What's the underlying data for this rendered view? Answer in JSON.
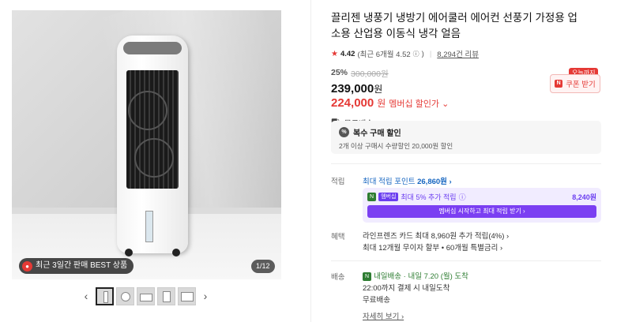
{
  "gallery": {
    "best_badge": "최근 3일간 판매 BEST 상품",
    "counter": "1/12",
    "prev_icon": "chevron-left-icon",
    "next_icon": "chevron-right-icon"
  },
  "product": {
    "title": "끌리젠 냉풍기 냉방기 에어쿨러 에어컨 선풍기 가정용 업소용 산업용 이동식 냉각 얼음",
    "rating": {
      "score": "4.42",
      "recent": "(최근 6개월 4.52",
      "recent_close": ")",
      "reviews": "8,294건 리뷰"
    },
    "discount_pct": "25%",
    "original_price": "300,000원",
    "price": "239,000",
    "price_unit": "원",
    "member_price": "224,000",
    "member_price_unit": "원",
    "member_price_label": "멤버십 할인가 ⌄",
    "shipping": "무료배송"
  },
  "coupon": {
    "today_tag": "오늘까지",
    "label": "쿠폰 받기",
    "icon_text": "N"
  },
  "multi_buy": {
    "title": "복수 구매 할인",
    "desc": "2개 이상 구매시 수량할인 20,000원 할인",
    "icon_text": "%"
  },
  "points": {
    "label": "적립",
    "text": "최대 적립 포인트",
    "amount": "26,860원 ›",
    "member": {
      "tag_n": "N",
      "tag_m": "멤버십",
      "text": "최대 5% 추가 적립",
      "amount": "8,240원",
      "button": "멤버십 시작하고 최대 적립 받기 ›"
    }
  },
  "benefit": {
    "label": "혜택",
    "line1": "라인프렌즈 카드 최대 8,960원 추가 적립(4%) ›",
    "line2": "최대 12개월 무이자 할부 • 60개월 특별금리 ›"
  },
  "delivery": {
    "label": "배송",
    "fast_tag": "N",
    "fast_text": "내일배송 · 내일 7.20 (월) 도착",
    "line2": "22:00까지 결제 시 내일도착",
    "line3": "무료배송",
    "more": "자세히 보기 ›"
  },
  "colors": {
    "accent_red": "#e53935",
    "member_purple": "#7b3ff2",
    "points_blue": "#1565c0",
    "delivery_green": "#2e7d32"
  }
}
